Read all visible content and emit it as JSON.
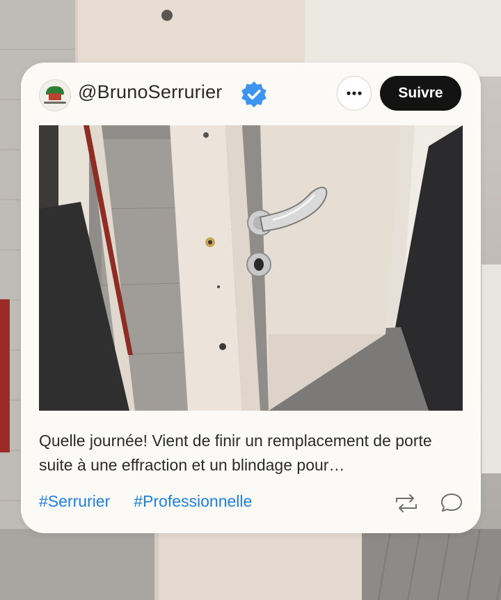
{
  "post": {
    "handle": "@BrunoSerrurier",
    "follow_label": "Suivre",
    "caption": "Quelle journée! Vient de finir un remplacement de porte suite à une effraction et un blindage pour…",
    "hashtags": [
      "#Serrurier",
      "#Professionnelle"
    ]
  },
  "icons": {
    "verified": "verified-badge-icon",
    "more": "more-options-icon",
    "repost": "repost-icon",
    "comment": "comment-icon"
  },
  "colors": {
    "accent": "#1d7fe0",
    "verified": "#3d95f0",
    "follow_button": "#131313",
    "card": "#fbfaf7"
  }
}
